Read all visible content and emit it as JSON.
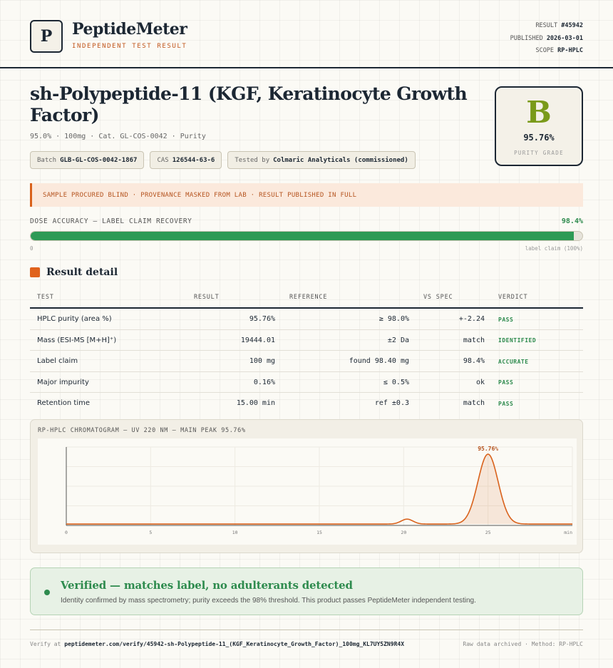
{
  "brand": {
    "logo_letter": "P",
    "name": "PeptideMeter",
    "subtitle": "INDEPENDENT TEST RESULT"
  },
  "meta": {
    "result_label": "RESULT",
    "result_value": "#45942",
    "published_label": "PUBLISHED",
    "published_value": "2026-03-01",
    "scope_label": "SCOPE",
    "scope_value": "RP-HPLC"
  },
  "product": {
    "title": "sh-Polypeptide-11 (KGF, Keratinocyte Growth Factor)",
    "subline": "95.0% · 100mg · Cat. GL-COS-0042 · Purity",
    "chips": [
      {
        "label": "Batch",
        "value": "GLB-GL-COS-0042-1867"
      },
      {
        "label": "CAS",
        "value": "126544-63-6"
      },
      {
        "label": "Tested by",
        "value": "Colmaric Analyticals (commissioned)"
      }
    ]
  },
  "grade": {
    "letter": "B",
    "value": "95.76%",
    "label": "PURITY GRADE",
    "color": "#7a9a1a"
  },
  "notice": "SAMPLE PROCURED BLIND · PROVENANCE MASKED FROM LAB · RESULT PUBLISHED IN FULL",
  "dose": {
    "label": "DOSE ACCURACY — LABEL CLAIM RECOVERY",
    "value_text": "98.4%",
    "fraction": 0.984,
    "min_label": "0",
    "max_label": "label claim (100%)",
    "color": "#2d9a55"
  },
  "result_detail": {
    "title": "Result detail",
    "headers": {
      "test": "TEST",
      "result": "RESULT",
      "reference": "REFERENCE",
      "vs_spec": "VS SPEC",
      "verdict": "VERDICT"
    },
    "rows": [
      {
        "test": "HPLC purity (area %)",
        "result": "95.76%",
        "reference": "≥ 98.0%",
        "vs_spec": "+-2.24",
        "verdict": "PASS"
      },
      {
        "test": "Mass (ESI-MS [M+H]⁺)",
        "result": "19444.01",
        "reference": "±2 Da",
        "vs_spec": "match",
        "verdict": "IDENTIFIED"
      },
      {
        "test": "Label claim",
        "result": "100 mg",
        "reference": "found 98.40 mg",
        "vs_spec": "98.4%",
        "verdict": "ACCURATE"
      },
      {
        "test": "Major impurity",
        "result": "0.16%",
        "reference": "≤ 0.5%",
        "vs_spec": "ok",
        "verdict": "PASS"
      },
      {
        "test": "Retention time",
        "result": "15.00 min",
        "reference": "ref ±0.3",
        "vs_spec": "match",
        "verdict": "PASS"
      }
    ]
  },
  "chromatogram": {
    "title": "RP-HPLC CHROMATOGRAM — UV 220 NM — MAIN PEAK 95.76%",
    "peak_label": "95.76%",
    "x_ticks": [
      "0",
      "5",
      "10",
      "15",
      "20",
      "25",
      "min"
    ],
    "line_color": "#d9621c"
  },
  "chart_data": {
    "type": "line",
    "title": "RP-HPLC CHROMATOGRAM — UV 220 NM — MAIN PEAK 95.76%",
    "xlabel": "min",
    "ylabel": "",
    "xlim": [
      0,
      30
    ],
    "x_ticks": [
      0,
      5,
      10,
      15,
      20,
      25
    ],
    "grid": true,
    "series": [
      {
        "peaks": [
          {
            "x": 20.2,
            "height": 0.07,
            "width": 0.35
          },
          {
            "x": 25.0,
            "height": 1.0,
            "width": 0.6
          }
        ],
        "baseline": 0.02
      }
    ],
    "annotations": [
      {
        "x": 25.0,
        "text": "95.76%"
      }
    ]
  },
  "verified": {
    "title": "Verified — matches label, no adulterants detected",
    "text": "Identity confirmed by mass spectrometry; purity exceeds the 98% threshold. This product passes PeptideMeter independent testing."
  },
  "footer": {
    "verify_prefix": "Verify at",
    "verify_url": "peptidemeter.com/verify/45942-sh-Polypeptide-11_(KGF_Keratinocyte_Growth_Factor)_100mg_KL7UY5ZN9R4X",
    "right_text": "Raw data archived · Method: RP-HPLC"
  }
}
